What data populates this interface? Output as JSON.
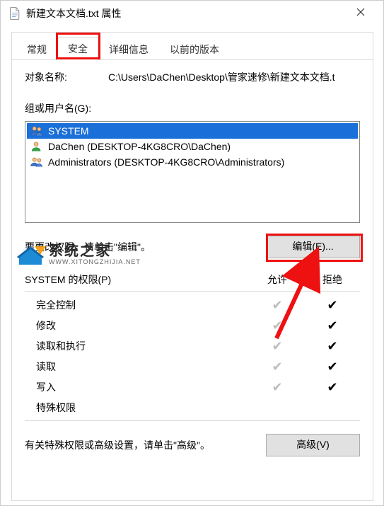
{
  "window": {
    "title": "新建文本文档.txt 属性"
  },
  "tabs": {
    "items": [
      {
        "label": "常规"
      },
      {
        "label": "安全"
      },
      {
        "label": "详细信息"
      },
      {
        "label": "以前的版本"
      }
    ],
    "active_index": 1
  },
  "object": {
    "label": "对象名称:",
    "value": "C:\\Users\\DaChen\\Desktop\\管家速修\\新建文本文档.t"
  },
  "groups": {
    "label": "组或用户名(G):",
    "items": [
      {
        "name": "SYSTEM",
        "icon": "group",
        "selected": true
      },
      {
        "name": "DaChen (DESKTOP-4KG8CRO\\DaChen)",
        "icon": "user",
        "selected": false
      },
      {
        "name": "Administrators (DESKTOP-4KG8CRO\\Administrators)",
        "icon": "group",
        "selected": false
      }
    ]
  },
  "edit_hint": "要更改权限，请单击\"编辑\"。",
  "edit_button": "编辑(E)...",
  "perm_header": {
    "label": "SYSTEM 的权限(P)",
    "allow": "允许",
    "deny": "拒绝"
  },
  "permissions": [
    {
      "name": "完全控制",
      "allow": true,
      "deny": true
    },
    {
      "name": "修改",
      "allow": true,
      "deny": true
    },
    {
      "name": "读取和执行",
      "allow": true,
      "deny": true
    },
    {
      "name": "读取",
      "allow": true,
      "deny": true
    },
    {
      "name": "写入",
      "allow": true,
      "deny": true
    },
    {
      "name": "特殊权限",
      "allow": false,
      "deny": false
    }
  ],
  "advanced_hint": "有关特殊权限或高级设置，请单击\"高级\"。",
  "advanced_button": "高级(V)",
  "watermark": {
    "name": "系统之家",
    "url": "WWW.XITONGZHIJIA.NET"
  }
}
